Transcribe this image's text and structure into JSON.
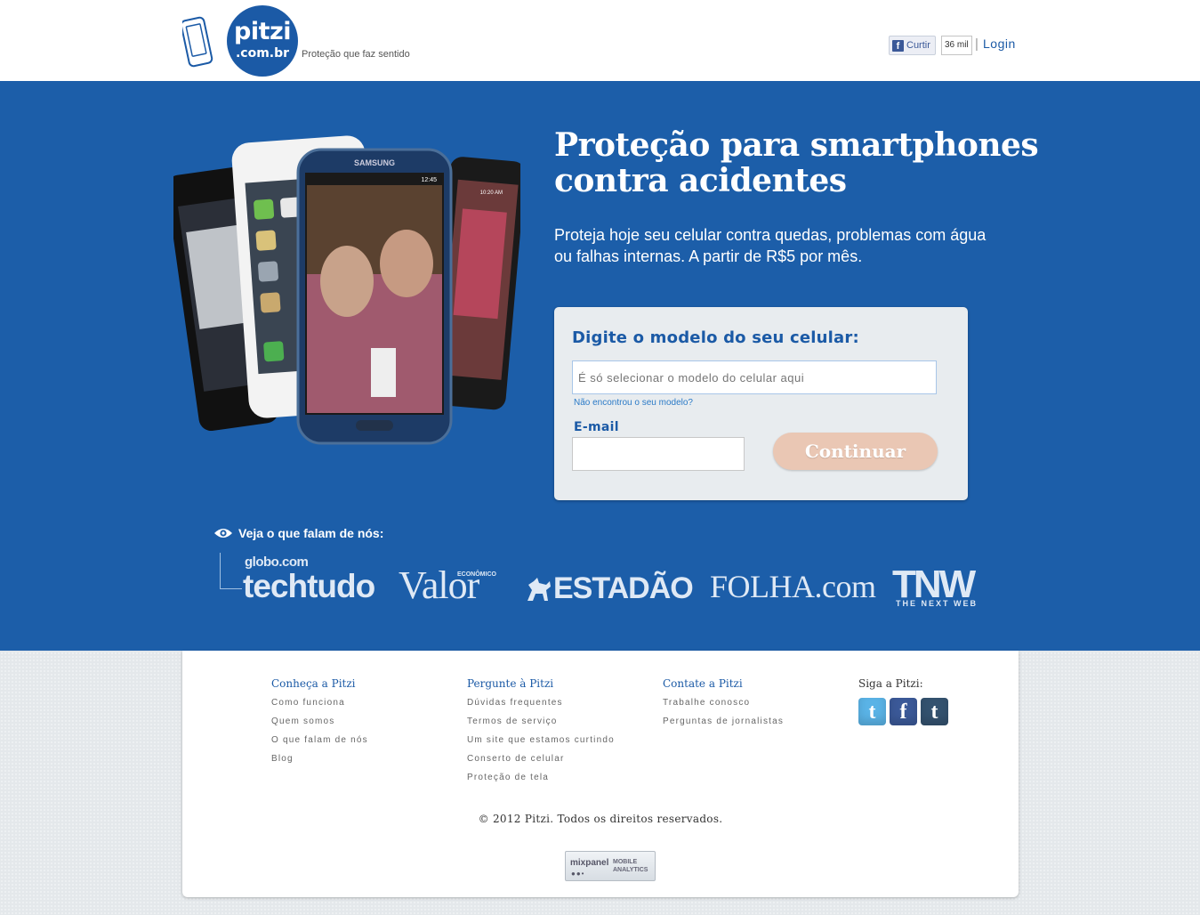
{
  "header": {
    "logo_line1": "pitzi",
    "logo_line2": ".com.br",
    "tagline": "Proteção que faz sentido",
    "like_label": "Curtir",
    "like_count": "36 mil",
    "separator": "|",
    "login_label": "Login"
  },
  "hero": {
    "headline": "Proteção para smartphones contra acidentes",
    "subtitle": "Proteja hoje seu celular contra quedas, problemas com água ou falhas internas. A partir de R$5 por mês.",
    "phone_brand": "SAMSUNG",
    "phone_time": "12:45",
    "phone_time2": "10:20 AM"
  },
  "form": {
    "title": "Digite o modelo do seu celular:",
    "model_placeholder": "É só selecionar o modelo do celular aqui",
    "not_found_link": "Não encontrou o seu modelo?",
    "email_label": "E-mail",
    "email_value": "",
    "continue_label": "Continuar"
  },
  "press": {
    "title": "Veja o que falam de nós:",
    "globo": "globo.com",
    "techtudo": "techtudo",
    "valor": "Valor",
    "valor_small": "ECONÔMICO",
    "estadao": "ESTADÃO",
    "folha": "FOLHA.com",
    "tnw": "TNW",
    "tnw_sub": "THE NEXT WEB"
  },
  "footer": {
    "columns": [
      {
        "title": "Conheça a Pitzi",
        "links": [
          "Como funciona",
          "Quem somos",
          "O que falam de nós",
          "Blog"
        ]
      },
      {
        "title": "Pergunte à Pitzi",
        "links": [
          "Dúvidas frequentes",
          "Termos de serviço",
          "Um site que estamos curtindo",
          "Conserto de celular",
          "Proteção de tela"
        ]
      },
      {
        "title": "Contate a Pitzi",
        "links": [
          "Trabalhe conosco",
          "Perguntas de jornalistas"
        ]
      }
    ],
    "social_title": "Siga a Pitzi:",
    "social": [
      {
        "name": "twitter-icon",
        "glyph": "t",
        "color": "#5ab3e6"
      },
      {
        "name": "facebook-icon",
        "glyph": "f",
        "color": "#3b5998"
      },
      {
        "name": "tumblr-icon",
        "glyph": "t",
        "color": "#34526f"
      }
    ],
    "copyright": "© 2012 Pitzi. Todos os direitos reservados.",
    "mixpanel_brand": "mixpanel",
    "mixpanel_line1": "MOBILE",
    "mixpanel_line2": "ANALYTICS"
  },
  "colors": {
    "brand_blue": "#1c5ea9",
    "button_disabled": "#eac7b4",
    "link_blue": "#2a7ac7"
  }
}
